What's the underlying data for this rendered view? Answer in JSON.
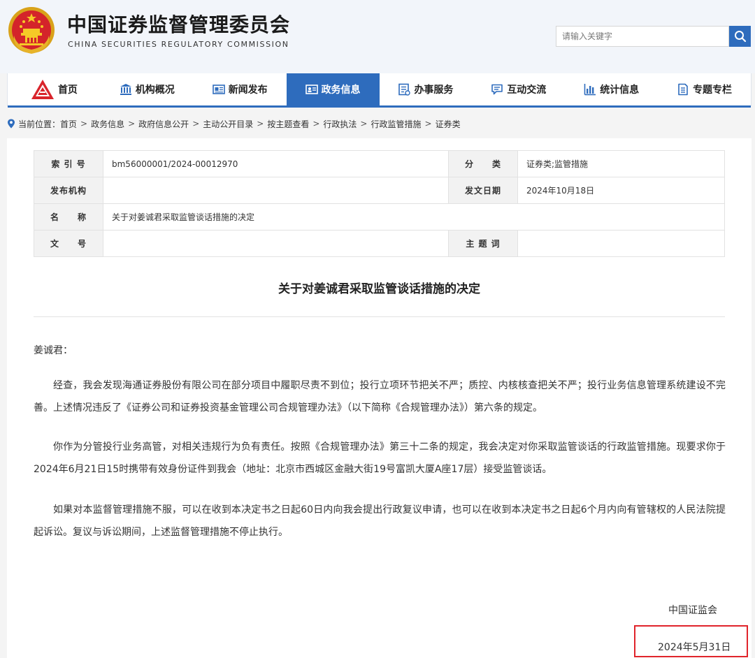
{
  "header": {
    "title_cn": "中国证券监督管理委员会",
    "title_en": "CHINA SECURITIES REGULATORY COMMISSION",
    "search_placeholder": "请输入关键字",
    "emblem_icon": "national-emblem-icon",
    "search_icon": "search-icon"
  },
  "nav": {
    "items": [
      {
        "label": "首页",
        "icon": "csrc-logo-icon",
        "active": false
      },
      {
        "label": "机构概况",
        "icon": "building-icon",
        "active": false
      },
      {
        "label": "新闻发布",
        "icon": "newspaper-icon",
        "active": false
      },
      {
        "label": "政务信息",
        "icon": "info-card-icon",
        "active": true
      },
      {
        "label": "办事服务",
        "icon": "service-list-icon",
        "active": false
      },
      {
        "label": "互动交流",
        "icon": "chat-icon",
        "active": false
      },
      {
        "label": "统计信息",
        "icon": "bar-chart-icon",
        "active": false
      },
      {
        "label": "专题专栏",
        "icon": "document-icon",
        "active": false
      }
    ],
    "accent_color": "#2e6cbd"
  },
  "breadcrumb": {
    "prefix": "当前位置：",
    "items": [
      "首页",
      "政务信息",
      "政府信息公开",
      "主动公开目录",
      "按主题查看",
      "行政执法",
      "行政监管措施",
      "证券类"
    ]
  },
  "meta": {
    "index_label": "索 引 号",
    "index_value": "bm56000001/2024-00012970",
    "category_label": "分　　类",
    "category_value": "证券类;监管措施",
    "issuer_label": "发布机构",
    "issuer_value": "",
    "date_label": "发文日期",
    "date_value": "2024年10月18日",
    "name_label": "名　　称",
    "name_value": "关于对姜诚君采取监管谈话措施的决定",
    "docno_label": "文　　号",
    "docno_value": "",
    "subject_label": "主 题 词",
    "subject_value": ""
  },
  "document": {
    "title": "关于对姜诚君采取监管谈话措施的决定",
    "salutation": "姜诚君：",
    "paragraphs": [
      "经查，我会发现海通证券股份有限公司在部分项目中履职尽责不到位；投行立项环节把关不严；质控、内核核查把关不严；投行业务信息管理系统建设不完善。上述情况违反了《证券公司和证券投资基金管理公司合规管理办法》（以下简称《合规管理办法》）第六条的规定。",
      "你作为分管投行业务高管，对相关违规行为负有责任。按照《合规管理办法》第三十二条的规定，我会决定对你采取监管谈话的行政监管措施。现要求你于2024年6月21日15时携带有效身份证件到我会（地址：北京市西城区金融大街19号富凯大厦A座17层）接受监管谈话。",
      "如果对本监督管理措施不服，可以在收到本决定书之日起60日内向我会提出行政复议申请，也可以在收到本决定书之日起6个月内向有管辖权的人民法院提起诉讼。复议与诉讼期间，上述监督管理措施不停止执行。"
    ],
    "signature_org": "中国证监会",
    "signature_date": "2024年5月31日",
    "highlight_color": "#e0242b"
  }
}
